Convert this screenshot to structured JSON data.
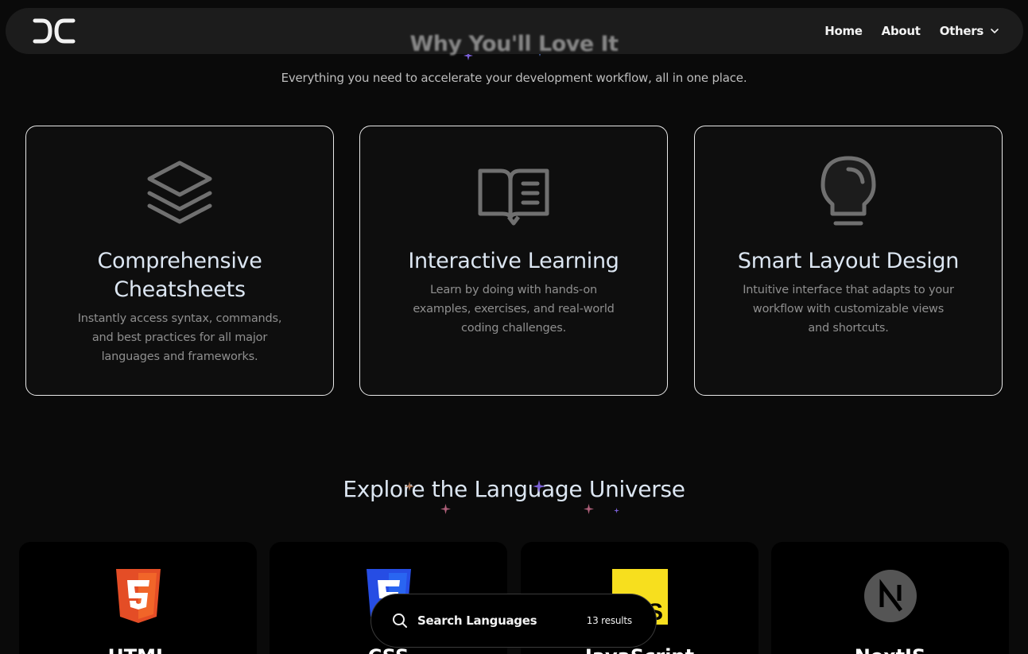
{
  "navbar": {
    "logo_text": "DC",
    "links": [
      {
        "label": "Home"
      },
      {
        "label": "About"
      },
      {
        "label": "Others"
      }
    ]
  },
  "features_section": {
    "title": "Why You'll Love It",
    "subtitle": "Everything you need to accelerate your development workflow, all in one place.",
    "cards": [
      {
        "icon": "layers-icon",
        "title": "Comprehensive Cheatsheets",
        "description": "Instantly access syntax, commands, and best practices for all major languages and frameworks."
      },
      {
        "icon": "book-open-icon",
        "title": "Interactive Learning",
        "description": "Learn by doing with hands-on examples, exercises, and real-world coding challenges."
      },
      {
        "icon": "lightbulb-icon",
        "title": "Smart Layout Design",
        "description": "Intuitive interface that adapts to your workflow with customizable views and shortcuts."
      }
    ]
  },
  "languages_section": {
    "title": "Explore the Language Universe",
    "cards": [
      {
        "name": "HTML",
        "icon": "html5-icon",
        "color": "#e44d26"
      },
      {
        "name": "CSS",
        "icon": "css3-icon",
        "color": "#264de4"
      },
      {
        "name": "JavaScript",
        "icon": "javascript-icon",
        "color": "#f7df1e"
      },
      {
        "name": "NextJS",
        "icon": "nextjs-icon",
        "color": "#555555"
      }
    ]
  },
  "search": {
    "label": "Search Languages",
    "count": "13 results"
  },
  "colors": {
    "background": "#0a0a0a",
    "card_border": "#e8e8e8",
    "heading": "#dce6f2"
  }
}
